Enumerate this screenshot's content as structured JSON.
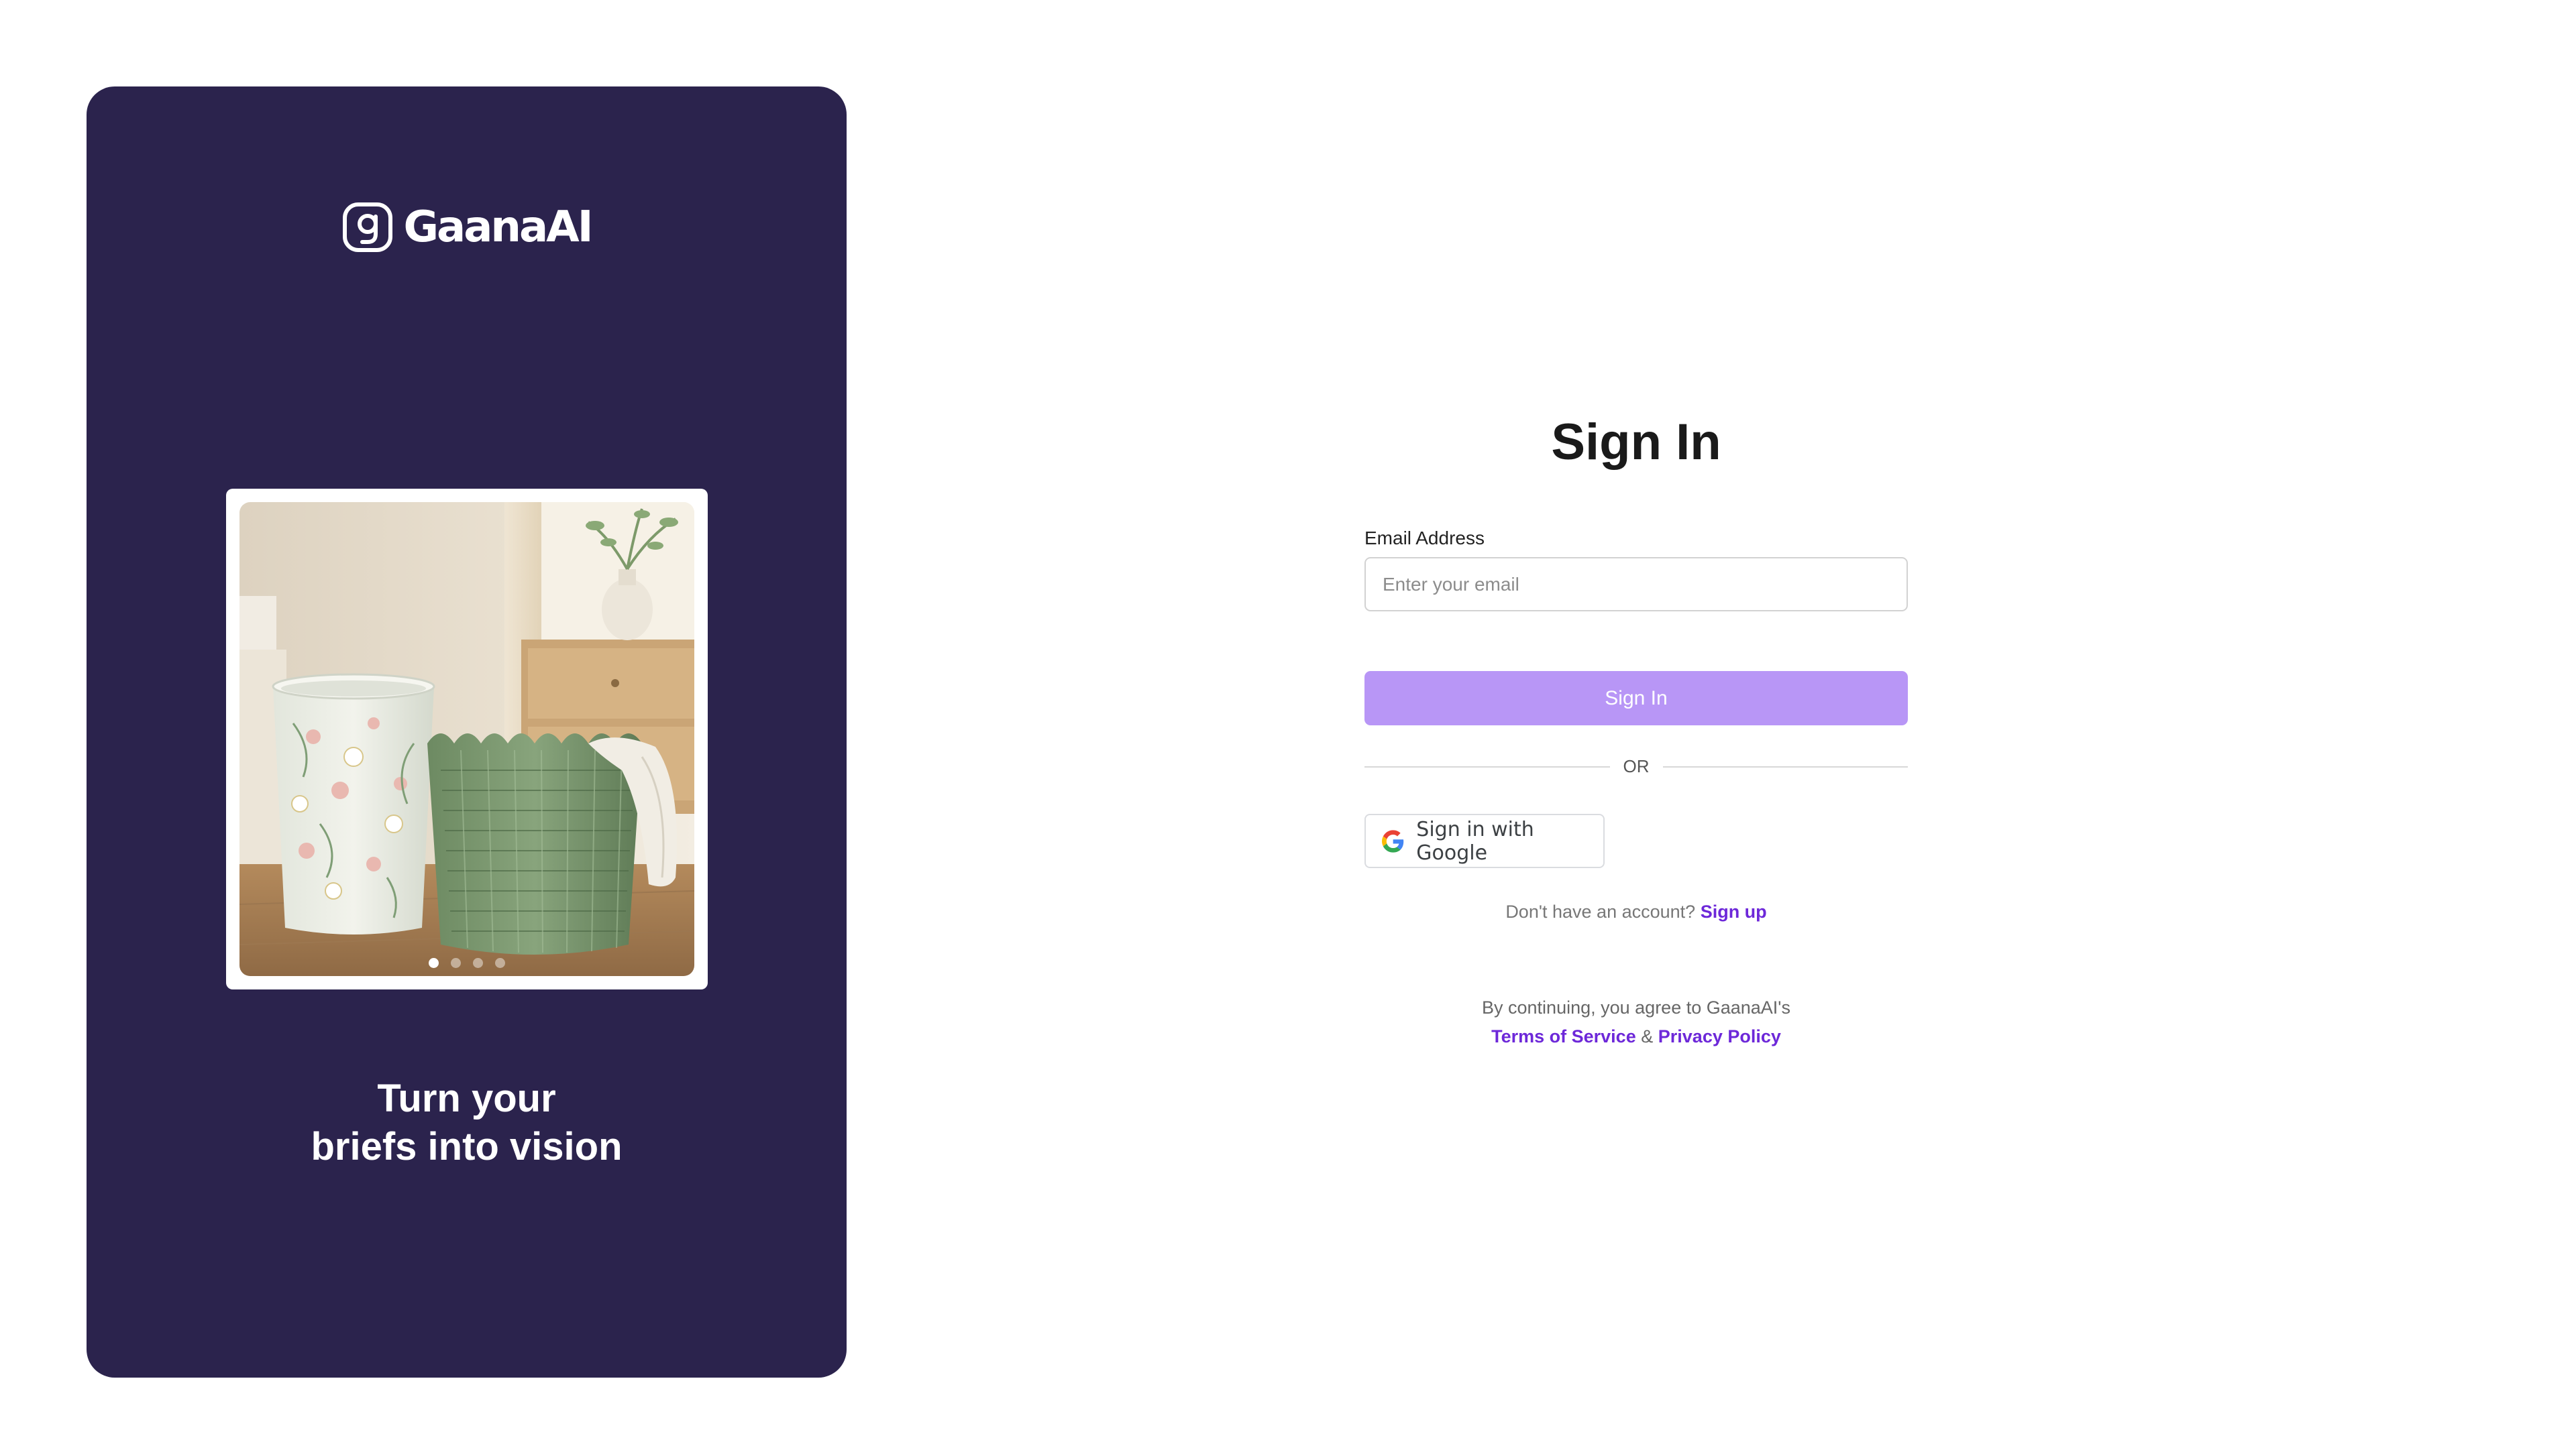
{
  "brand": {
    "name": "GaanaAI",
    "logo_icon": "gaana-logo-icon",
    "panel_color": "#2b234d"
  },
  "carousel": {
    "image": "product-photo-laundry-baskets",
    "slide_count": 4,
    "active_index": 0
  },
  "tagline": {
    "line1": "Turn your",
    "line2": "briefs into vision"
  },
  "form": {
    "title": "Sign In",
    "email_label": "Email Address",
    "email_placeholder": "Enter your email",
    "email_value": "",
    "submit_label": "Sign In",
    "submit_color": "#b896f6",
    "divider_text": "OR",
    "google_label": "Sign in with Google",
    "google_icon": "google-icon",
    "signup_prompt": "Don't have an account?",
    "signup_link": "Sign up",
    "legal_prefix": "By continuing, you agree to GaanaAI's",
    "terms_link": "Terms of Service",
    "legal_joiner": "&",
    "privacy_link": "Privacy Policy",
    "link_color": "#6d28d9"
  }
}
